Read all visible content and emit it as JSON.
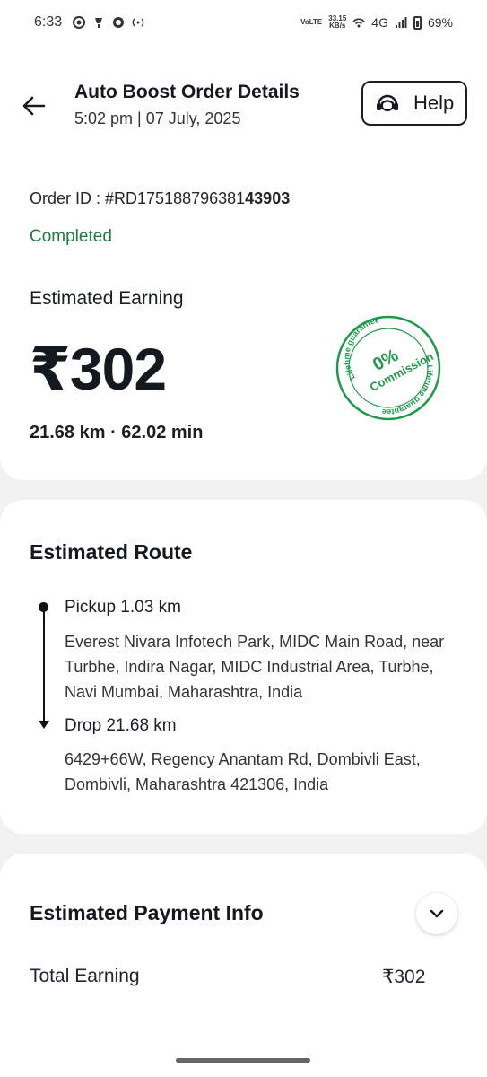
{
  "status_bar": {
    "time": "6:33",
    "net_top": "VoLTE",
    "speed_value": "33.15",
    "speed_unit": "KB/s",
    "network": "4G",
    "battery": "69%"
  },
  "header": {
    "title": "Auto Boost Order Details",
    "subtitle": "5:02 pm | 07 July, 2025",
    "help_label": "Help"
  },
  "order": {
    "id_prefix": "Order ID : #RD175188796381",
    "id_suffix": "43903",
    "status": "Completed",
    "earning_label": "Estimated Earning",
    "amount": "₹302",
    "distance_time": "21.68 km · 62.02 min"
  },
  "seal": {
    "top_text": "Lifetime guarantee",
    "percent": "0%",
    "word": "Commission",
    "bottom_text": "Lifetime guarantee",
    "color": "#1e9a4a"
  },
  "route": {
    "title": "Estimated Route",
    "pickup_label": "Pickup 1.03 km",
    "pickup_address": "Everest Nivara Infotech Park, MIDC Main Road, near Turbhe, Indira Nagar, MIDC Industrial Area, Turbhe, Navi Mumbai, Maharashtra, India",
    "drop_label": "Drop 21.68 km",
    "drop_address": "6429+66W, Regency Anantam Rd, Dombivli East, Dombivli, Maharashtra 421306, India"
  },
  "payment": {
    "title": "Estimated Payment Info",
    "total_label": "Total Earning",
    "total_value": "₹302"
  },
  "colors": {
    "success": "#1e7d3c",
    "background": "#f2f2f2",
    "card": "#ffffff"
  }
}
